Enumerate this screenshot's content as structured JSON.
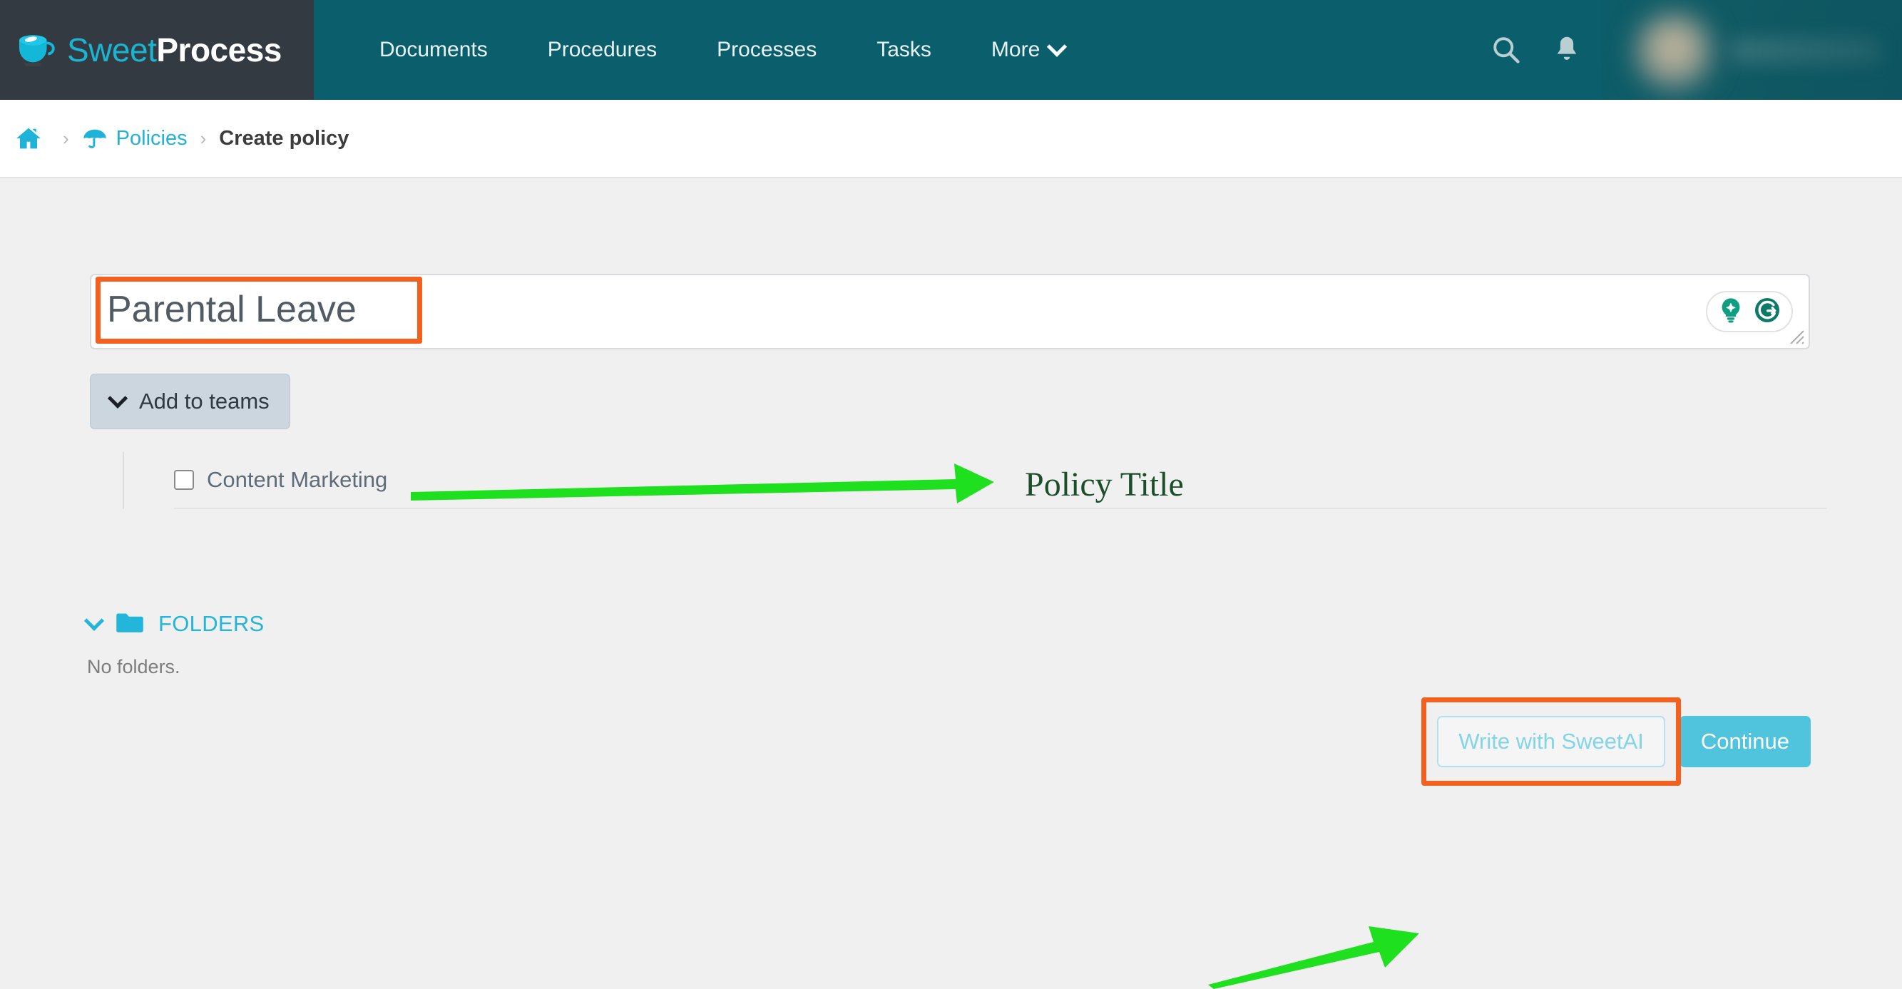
{
  "app": {
    "logo": {
      "icon": "coffee-cup-icon",
      "text_primary": "Sweet",
      "text_secondary": "Process"
    },
    "brand_colors": {
      "nav_teal": "#0b5f6d",
      "logo_block_dark": "#343a42",
      "cyan": "#23b5da",
      "continue_blue": "#50c4dd",
      "annotation_orange": "#f4601e",
      "annotation_green": "#1fe01f",
      "annotation_label_green": "#1d4e2b",
      "page_background": "#f0f0f0"
    }
  },
  "navbar": {
    "items": [
      {
        "label": "Documents"
      },
      {
        "label": "Procedures"
      },
      {
        "label": "Processes"
      },
      {
        "label": "Tasks"
      },
      {
        "label": "More"
      }
    ],
    "more_label": "More",
    "icons": [
      {
        "name": "search-icon"
      },
      {
        "name": "notification-bell-icon"
      }
    ],
    "user": {
      "avatar": "blurred-user-avatar",
      "name": "blurred-user-name"
    }
  },
  "breadcrumb": {
    "home_icon": "home-icon",
    "policies_icon": "umbrella-icon",
    "policies_label": "Policies",
    "separator": "›",
    "current_label": "Create policy"
  },
  "form": {
    "title_field": {
      "value": "Parental Leave",
      "placeholder": "Title",
      "helper_icons": [
        {
          "name": "lightbulb-idea-icon"
        },
        {
          "name": "grammarly-g-icon"
        }
      ],
      "resize_handle": "resize-handle-icon"
    },
    "add_to_teams": {
      "label": "Add to teams",
      "chevron": "chevron-down-icon",
      "teams": [
        {
          "label": "Content Marketing",
          "checked": false
        }
      ]
    },
    "folders": {
      "chevron": "chevron-down-icon",
      "folder_icon": "folder-icon",
      "label": "FOLDERS",
      "empty_text": "No folders."
    },
    "actions": {
      "write_with_sweetai": "Write with SweetAI",
      "continue": "Continue"
    }
  },
  "annotations": [
    {
      "type": "highlight-box",
      "target": "title-input-value",
      "color": "#f4601e"
    },
    {
      "type": "arrow",
      "direction": "right",
      "color": "#1fe01f",
      "label": "Policy Title"
    },
    {
      "type": "highlight-box",
      "target": "write-with-sweetai-button",
      "color": "#f4601e"
    },
    {
      "type": "arrow",
      "direction": "up-right",
      "color": "#1fe01f",
      "label": ""
    }
  ],
  "annotation_labels": {
    "policy_title": "Policy Title"
  }
}
